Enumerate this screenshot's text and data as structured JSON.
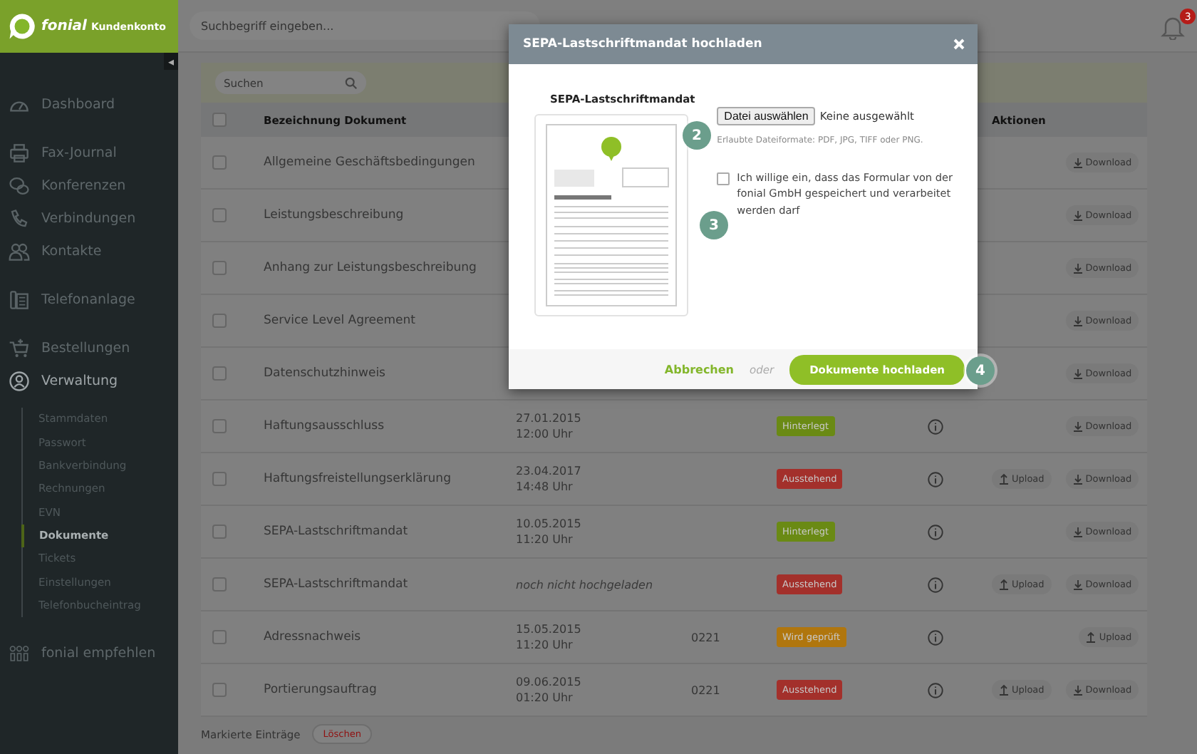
{
  "header": {
    "logo_brand": "fonial",
    "logo_subtitle": "Kundenkonto",
    "search_placeholder": "Suchbegriff eingeben...",
    "notification_count": "3",
    "collapse_glyph": "◂"
  },
  "sidebar": {
    "sections": [
      [
        {
          "label": "Dashboard"
        }
      ],
      [
        {
          "label": "Fax-Journal"
        },
        {
          "label": "Konferenzen"
        },
        {
          "label": "Verbindungen"
        },
        {
          "label": "Kontakte"
        }
      ],
      [
        {
          "label": "Telefonanlage"
        }
      ],
      [
        {
          "label": "Bestellungen"
        },
        {
          "label": "Verwaltung",
          "expanded": true,
          "children": [
            {
              "label": "Stammdaten",
              "selected": false
            },
            {
              "label": "Passwort",
              "selected": false
            },
            {
              "label": "Bankverbindung",
              "selected": false
            },
            {
              "label": "Rechnungen",
              "selected": false
            },
            {
              "label": "EVN",
              "selected": false
            },
            {
              "label": "Dokumente",
              "selected": true
            },
            {
              "label": "Tickets",
              "selected": false
            },
            {
              "label": "Einstellungen",
              "selected": false
            },
            {
              "label": "Telefonbucheintrag",
              "selected": false
            }
          ]
        }
      ],
      [
        {
          "label": "fonial empfehlen"
        }
      ]
    ]
  },
  "table": {
    "search_placeholder": "Suchen",
    "name_header": "Bezeichnung Dokument",
    "actions_header": "Aktionen",
    "header_checked": false,
    "rows": [
      {
        "checked": false,
        "name": "Allgemeine Geschäftsbedingungen",
        "actions": [
          {
            "kind": "download",
            "label": "Download"
          }
        ]
      },
      {
        "checked": false,
        "name": "Leistungsbeschreibung",
        "actions": [
          {
            "kind": "download",
            "label": "Download"
          }
        ]
      },
      {
        "checked": false,
        "name": "Anhang zur Leistungsbeschreibung",
        "actions": [
          {
            "kind": "download",
            "label": "Download"
          }
        ]
      },
      {
        "checked": false,
        "name": "Service Level Agreement",
        "actions": [
          {
            "kind": "download",
            "label": "Download"
          }
        ]
      },
      {
        "checked": false,
        "name": "Datenschutzhinweis",
        "actions": [
          {
            "kind": "download",
            "label": "Download"
          }
        ]
      },
      {
        "checked": false,
        "name": "Haftungsausschluss",
        "date": "27.01.2015",
        "time": "12:00 Uhr",
        "status": {
          "label": "Hinterlegt",
          "color": "#6a8a14"
        },
        "info": true,
        "actions": [
          {
            "kind": "download",
            "label": "Download"
          }
        ]
      },
      {
        "checked": false,
        "name": "Haftungsfreistellungserklärung",
        "date": "23.04.2017",
        "time": "14:48 Uhr",
        "status": {
          "label": "Ausstehend",
          "color": "#a3302b"
        },
        "info": true,
        "actions": [
          {
            "kind": "upload",
            "label": "Upload"
          },
          {
            "kind": "download",
            "label": "Download"
          }
        ]
      },
      {
        "checked": false,
        "name": "SEPA-Lastschriftmandat",
        "date": "10.05.2015",
        "time": "11:20 Uhr",
        "status": {
          "label": "Hinterlegt",
          "color": "#6a8a14"
        },
        "info": true,
        "actions": [
          {
            "kind": "download",
            "label": "Download"
          }
        ]
      },
      {
        "checked": false,
        "name": "SEPA-Lastschriftmandat",
        "date_note": "noch nicht hochgeladen",
        "status": {
          "label": "Ausstehend",
          "color": "#a3302b"
        },
        "info": true,
        "actions": [
          {
            "kind": "upload",
            "label": "Upload"
          },
          {
            "kind": "download",
            "label": "Download"
          }
        ]
      },
      {
        "checked": false,
        "name": "Adressnachweis",
        "date": "15.05.2015",
        "time": "11:20 Uhr",
        "number": "0221",
        "status": {
          "label": "Wird geprüft",
          "color": "#b0760e"
        },
        "info": true,
        "actions": [
          {
            "kind": "upload",
            "label": "Upload"
          }
        ]
      },
      {
        "checked": false,
        "name": "Portierungsauftrag",
        "date": "09.06.2015",
        "time": "01:20 Uhr",
        "number": "0221",
        "status": {
          "label": "Ausstehend",
          "color": "#a3302b"
        },
        "info": true,
        "actions": [
          {
            "kind": "upload",
            "label": "Upload"
          },
          {
            "kind": "download",
            "label": "Download"
          }
        ]
      }
    ],
    "footer_label": "Markierte Einträge",
    "delete_button": "Löschen"
  },
  "modal": {
    "title": "SEPA-Lastschriftmandat hochladen",
    "document_title": "SEPA-Lastschriftmandat",
    "file_button": "Datei auswählen",
    "file_status": "Keine ausgewählt",
    "hint": "Erlaubte Dateiformate: PDF, JPG, TIFF oder PNG.",
    "consent": {
      "label": "Ich willige ein, dass das Formular von der fonial GmbH gespeichert und verarbeitet werden darf",
      "checked": false
    },
    "cancel": "Abbrechen",
    "separator": "oder",
    "submit": "Dokumente hochladen",
    "steps": [
      "2",
      "3",
      "4"
    ]
  }
}
